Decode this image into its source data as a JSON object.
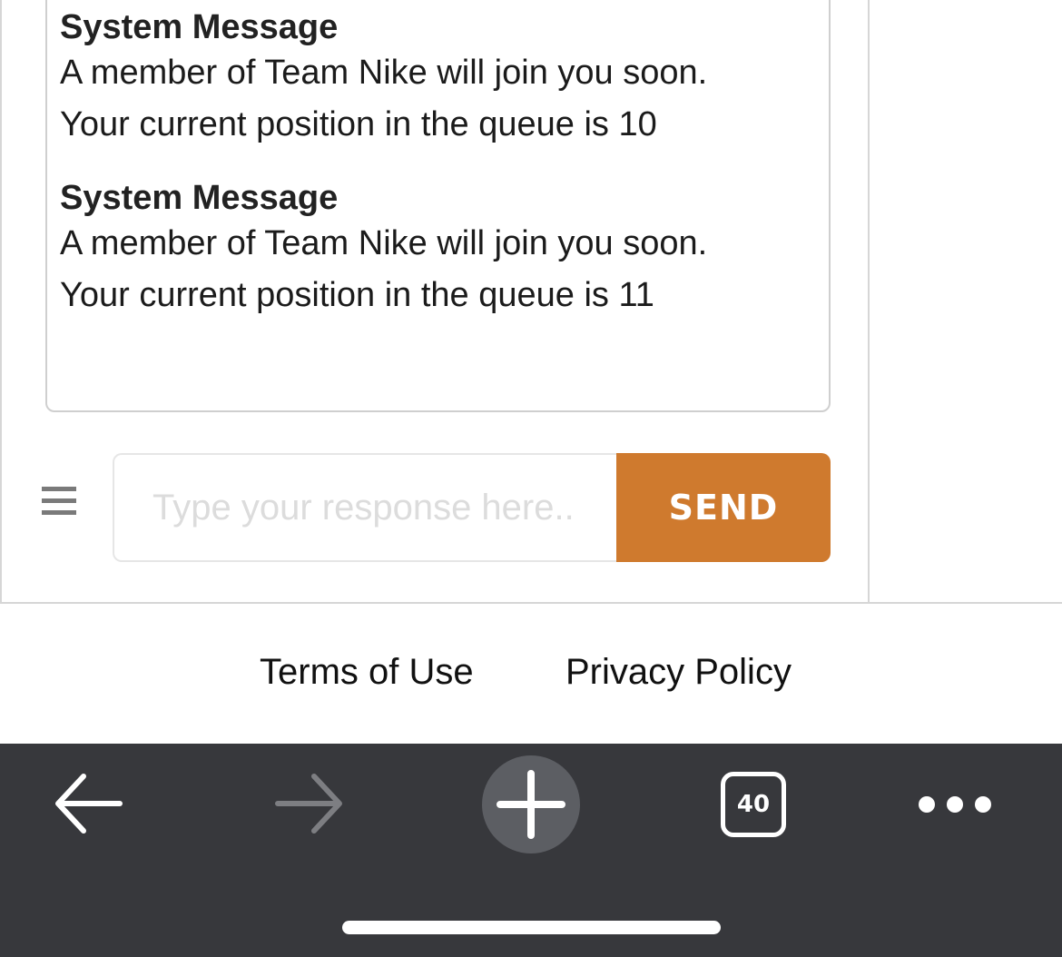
{
  "chat": {
    "messages": [
      {
        "sender": "System Message",
        "line1": "A member of Team Nike will join you soon.",
        "line2": "Your current position in the queue is 10"
      },
      {
        "sender": "System Message",
        "line1": "A member of Team Nike will join you soon.",
        "line2": "Your current position in the queue is 11"
      }
    ],
    "input": {
      "placeholder": "Type your response here..",
      "value": ""
    },
    "send_label": "SEND",
    "send_color": "#cf7a2e"
  },
  "footer": {
    "terms_label": "Terms of Use",
    "privacy_label": "Privacy Policy"
  },
  "browser_toolbar": {
    "background": "#37383c",
    "back_icon": "arrow-left-icon",
    "forward_icon": "arrow-right-icon",
    "new_tab_icon": "plus-icon",
    "tab_count": "40",
    "more_icon": "ellipsis-icon",
    "forward_enabled": false
  }
}
